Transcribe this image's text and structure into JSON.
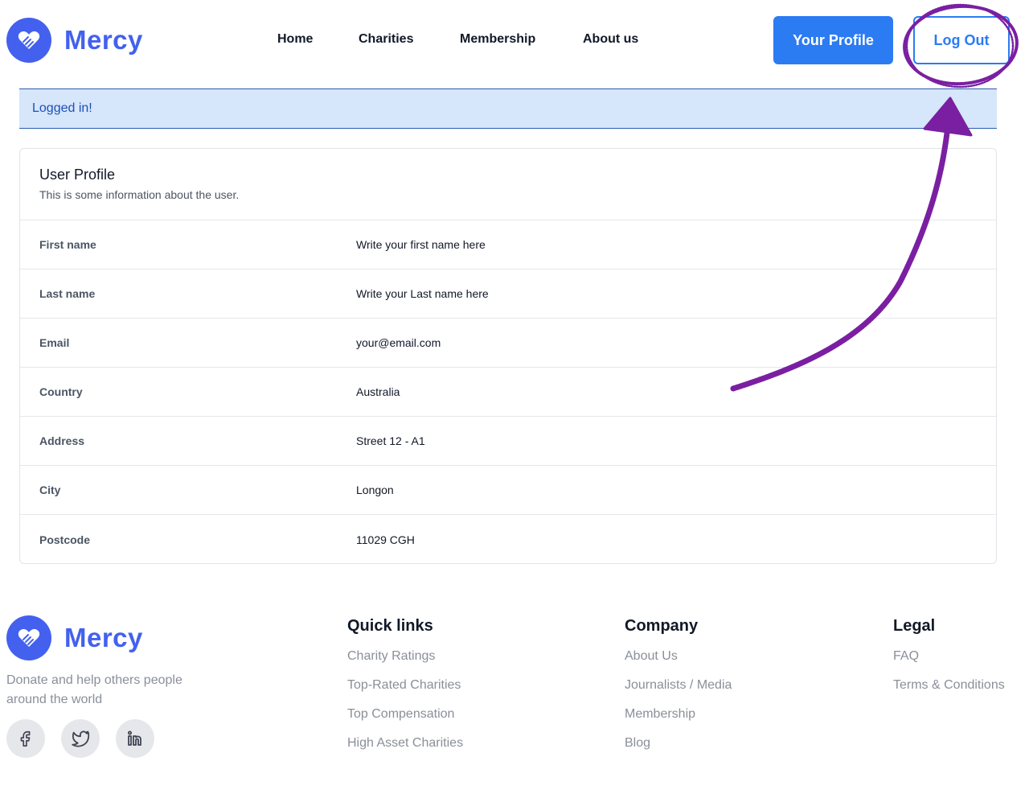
{
  "brand": {
    "name": "Mercy",
    "logo_icon": "heart-hands-icon",
    "color": "#4361ee"
  },
  "nav": {
    "items": [
      "Home",
      "Charities",
      "Membership",
      "About us"
    ]
  },
  "header": {
    "profile_label": "Your Profile",
    "logout_label": "Log Out",
    "accent_color": "#2b7bf3"
  },
  "alert": {
    "text": "Logged in!"
  },
  "profile": {
    "title": "User Profile",
    "subtitle": "This is some information about the user.",
    "fields": [
      {
        "label": "First name",
        "value": "Write your first name here"
      },
      {
        "label": "Last name",
        "value": "Write your Last name here"
      },
      {
        "label": "Email",
        "value": "your@email.com"
      },
      {
        "label": "Country",
        "value": "Australia"
      },
      {
        "label": "Address",
        "value": "Street 12 - A1"
      },
      {
        "label": "City",
        "value": "Longon"
      },
      {
        "label": "Postcode",
        "value": "11029 CGH"
      }
    ]
  },
  "footer": {
    "description": "Donate and help others people around the world",
    "socials": [
      "facebook-icon",
      "twitter-icon",
      "linkedin-icon"
    ],
    "columns": [
      {
        "title": "Quick links",
        "links": [
          "Charity Ratings",
          "Top-Rated Charities",
          "Top Compensation",
          "High Asset Charities"
        ]
      },
      {
        "title": "Company",
        "links": [
          "About Us",
          "Journalists / Media",
          "Membership",
          "Blog"
        ]
      },
      {
        "title": "Legal",
        "links": [
          "FAQ",
          "Terms & Conditions"
        ]
      }
    ]
  },
  "annotation": {
    "color": "#7a1fa2",
    "shapes": [
      "circle-around-logout",
      "arrow-to-logout"
    ]
  }
}
